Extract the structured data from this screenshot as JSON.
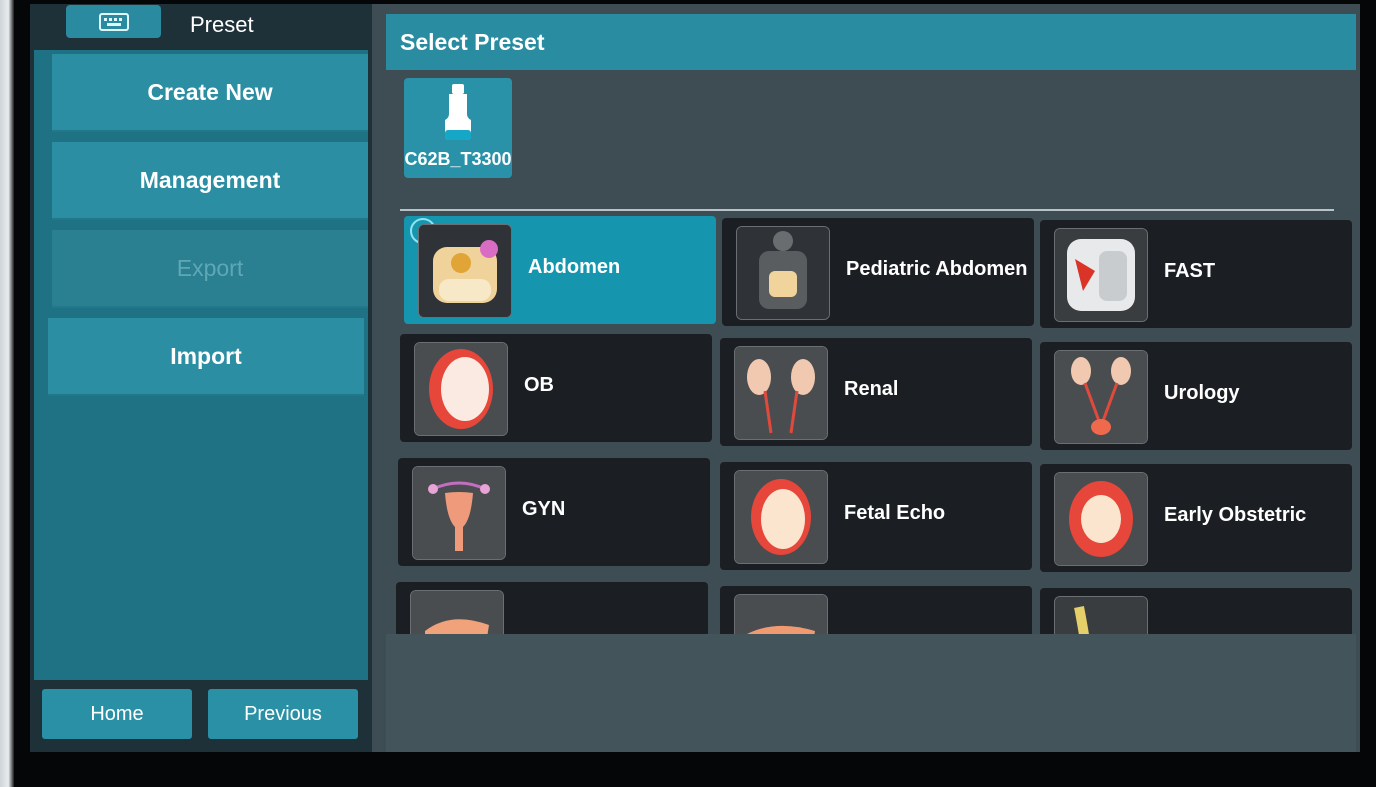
{
  "sidebar": {
    "title": "Preset",
    "menu": [
      {
        "label": "Create New",
        "enabled": true
      },
      {
        "label": "Management",
        "enabled": true
      },
      {
        "label": "Export",
        "enabled": false
      },
      {
        "label": "Import",
        "enabled": true
      }
    ],
    "home_label": "Home",
    "previous_label": "Previous"
  },
  "main": {
    "header": "Select Preset",
    "probe": {
      "label": "C62B_T3300",
      "icon": "probe-icon"
    },
    "presets": [
      {
        "label": "Abdomen",
        "selected": true,
        "icon": "abdomen-icon"
      },
      {
        "label": "Pediatric Abdomen",
        "selected": false,
        "icon": "pediatric-abdomen-icon"
      },
      {
        "label": "FAST",
        "selected": false,
        "icon": "fast-icon"
      },
      {
        "label": "OB",
        "selected": false,
        "icon": "ob-icon"
      },
      {
        "label": "Renal",
        "selected": false,
        "icon": "renal-icon"
      },
      {
        "label": "Urology",
        "selected": false,
        "icon": "urology-icon"
      },
      {
        "label": "GYN",
        "selected": false,
        "icon": "gyn-icon"
      },
      {
        "label": "Fetal Echo",
        "selected": false,
        "icon": "fetal-echo-icon"
      },
      {
        "label": "Early Obstetric",
        "selected": false,
        "icon": "early-obstetric-icon"
      }
    ]
  },
  "colors": {
    "accent": "#2a8ca0",
    "selected": "#1696ae",
    "tile": "#1b1f24"
  }
}
